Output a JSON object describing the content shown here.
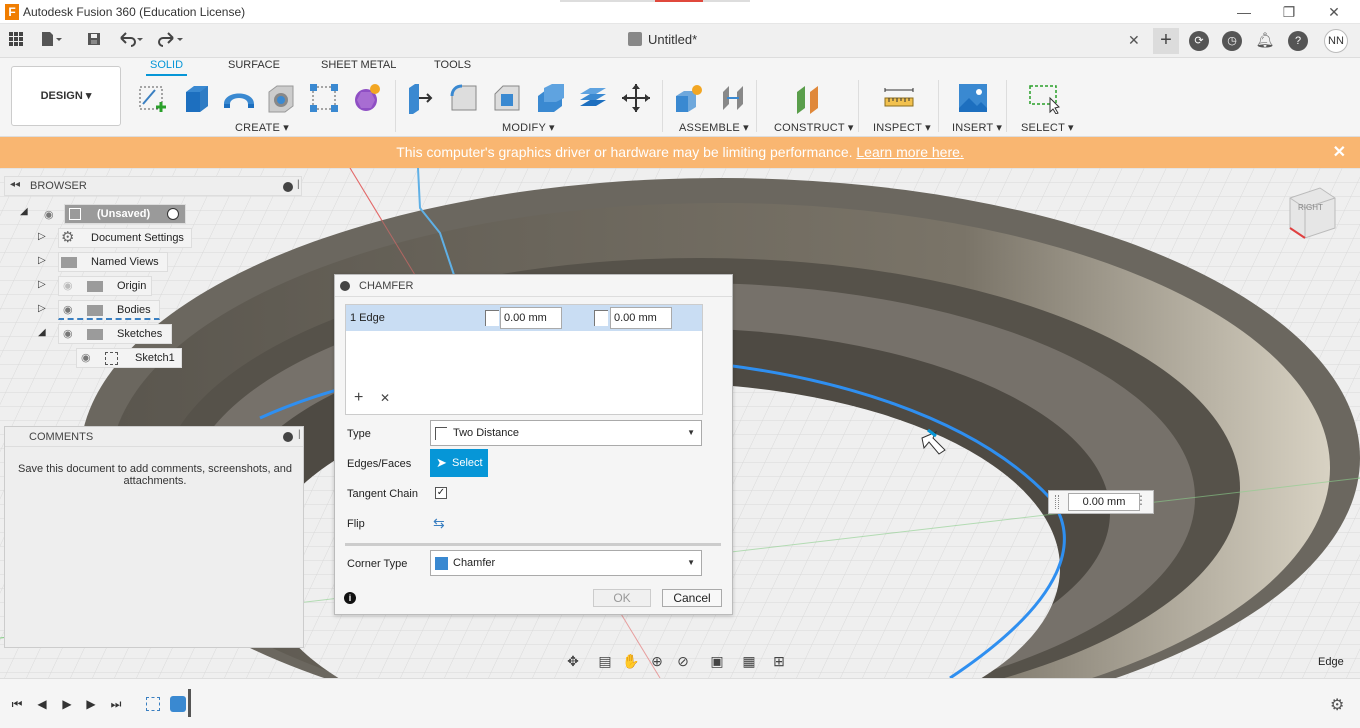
{
  "window": {
    "title": "Autodesk Fusion 360 (Education License)",
    "app_icon": "F",
    "controls": [
      "—",
      "❐",
      "✕"
    ]
  },
  "quickbar": {
    "doc_title": "Untitled*",
    "close": "✕",
    "new_tab": "+",
    "avatar": "NN"
  },
  "toolbar": {
    "workspace": "DESIGN ▾",
    "tabs": [
      "SOLID",
      "SURFACE",
      "SHEET METAL",
      "TOOLS"
    ],
    "groups": {
      "create": "CREATE ▾",
      "modify": "MODIFY ▾",
      "assemble": "ASSEMBLE ▾",
      "construct": "CONSTRUCT ▾",
      "inspect": "INSPECT ▾",
      "insert": "INSERT ▾",
      "select": "SELECT ▾"
    }
  },
  "banner": {
    "text": "This computer's graphics driver or hardware may be limiting performance.",
    "link": "Learn more here."
  },
  "browser": {
    "title": "BROWSER",
    "items": [
      {
        "label": "(Unsaved)"
      },
      {
        "label": "Document Settings"
      },
      {
        "label": "Named Views"
      },
      {
        "label": "Origin"
      },
      {
        "label": "Bodies"
      },
      {
        "label": "Sketches"
      },
      {
        "label": "Sketch1"
      }
    ]
  },
  "comments": {
    "title": "COMMENTS",
    "body": "Save this document to add comments, screenshots, and attachments."
  },
  "chamfer": {
    "title": "CHAMFER",
    "edge_label": "1 Edge",
    "dist1": "0.00 mm",
    "dist2": "0.00 mm",
    "add": "+",
    "remove": "✕",
    "type_label": "Type",
    "type_value": "Two Distance",
    "edges_label": "Edges/Faces",
    "select_label": "Select",
    "tangent_label": "Tangent Chain",
    "tangent_checked": "✓",
    "flip_label": "Flip",
    "corner_label": "Corner Type",
    "corner_value": "Chamfer",
    "ok": "OK",
    "cancel": "Cancel",
    "info": "i"
  },
  "viewport": {
    "float_value": "0.00 mm",
    "status": "Edge",
    "viewcube_label": "RIGHT"
  },
  "colors": {
    "accent": "#0696d7",
    "banner": "#f9b671",
    "selection_edge": "#2f8ff0"
  }
}
